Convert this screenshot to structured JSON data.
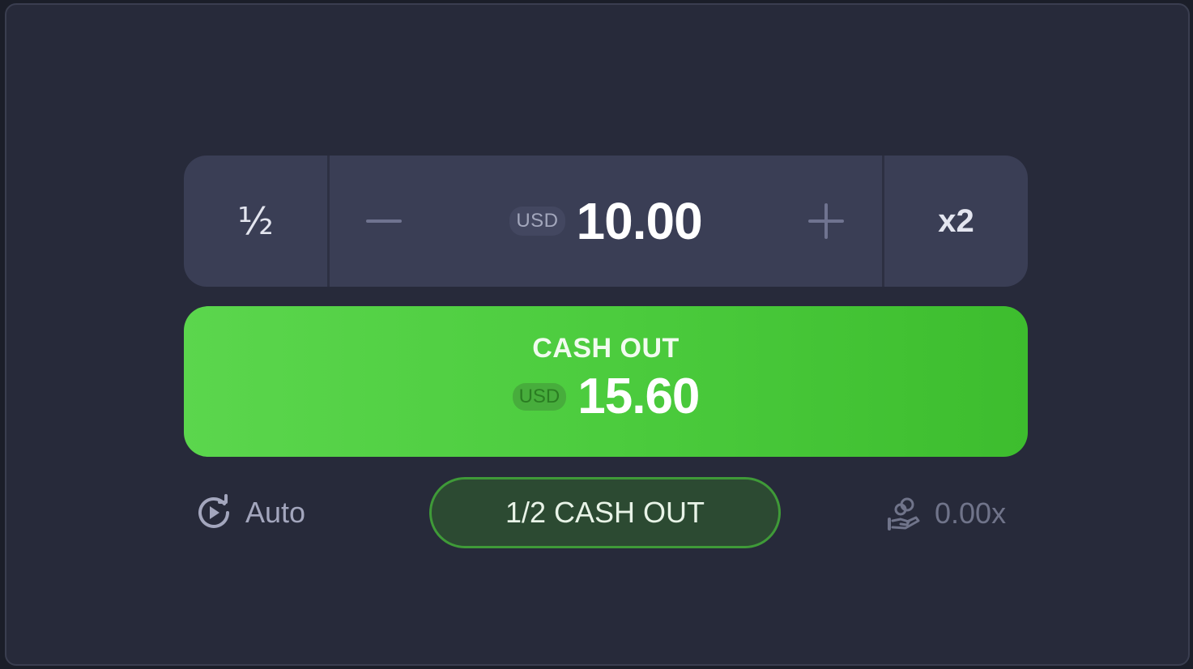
{
  "bet": {
    "half_label": "½",
    "minus_icon": "minus-icon",
    "plus_icon": "plus-icon",
    "currency": "USD",
    "amount": "10.00",
    "double_label": "x2"
  },
  "cashout": {
    "label": "CASH OUT",
    "currency": "USD",
    "amount": "15.60"
  },
  "auto": {
    "icon": "autoplay-icon",
    "label": "Auto"
  },
  "half_cashout": {
    "label": "1/2 CASH OUT"
  },
  "multiplier": {
    "icon": "coins-in-hand-icon",
    "value": "0.00x"
  },
  "colors": {
    "background": "#272a3a",
    "input_bg": "#3a3e55",
    "cashout_green": "#4ccc3e",
    "half_cashout_border": "#3f9a38"
  }
}
